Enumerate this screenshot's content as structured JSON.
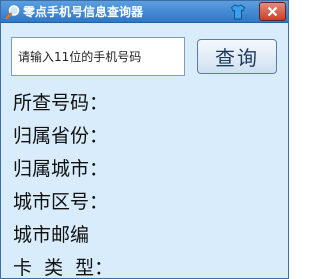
{
  "window": {
    "title": "零点手机号信息查询器"
  },
  "search": {
    "placeholder": "请输入11位的手机号码",
    "value": ""
  },
  "query_button": {
    "label": "查询"
  },
  "fields": [
    {
      "label": "所查号码："
    },
    {
      "label": "归属省份："
    },
    {
      "label": "归属城市："
    },
    {
      "label": "城市区号："
    },
    {
      "label": "城市邮编"
    },
    {
      "label": "卡  类  型："
    }
  ],
  "icons": {
    "app": "magnifier-icon",
    "skin": "shirt-icon",
    "close": "close-icon"
  },
  "colors": {
    "titlebar": "#2f77c8",
    "background": "#d9ecfb",
    "close_button": "#c8402c"
  }
}
